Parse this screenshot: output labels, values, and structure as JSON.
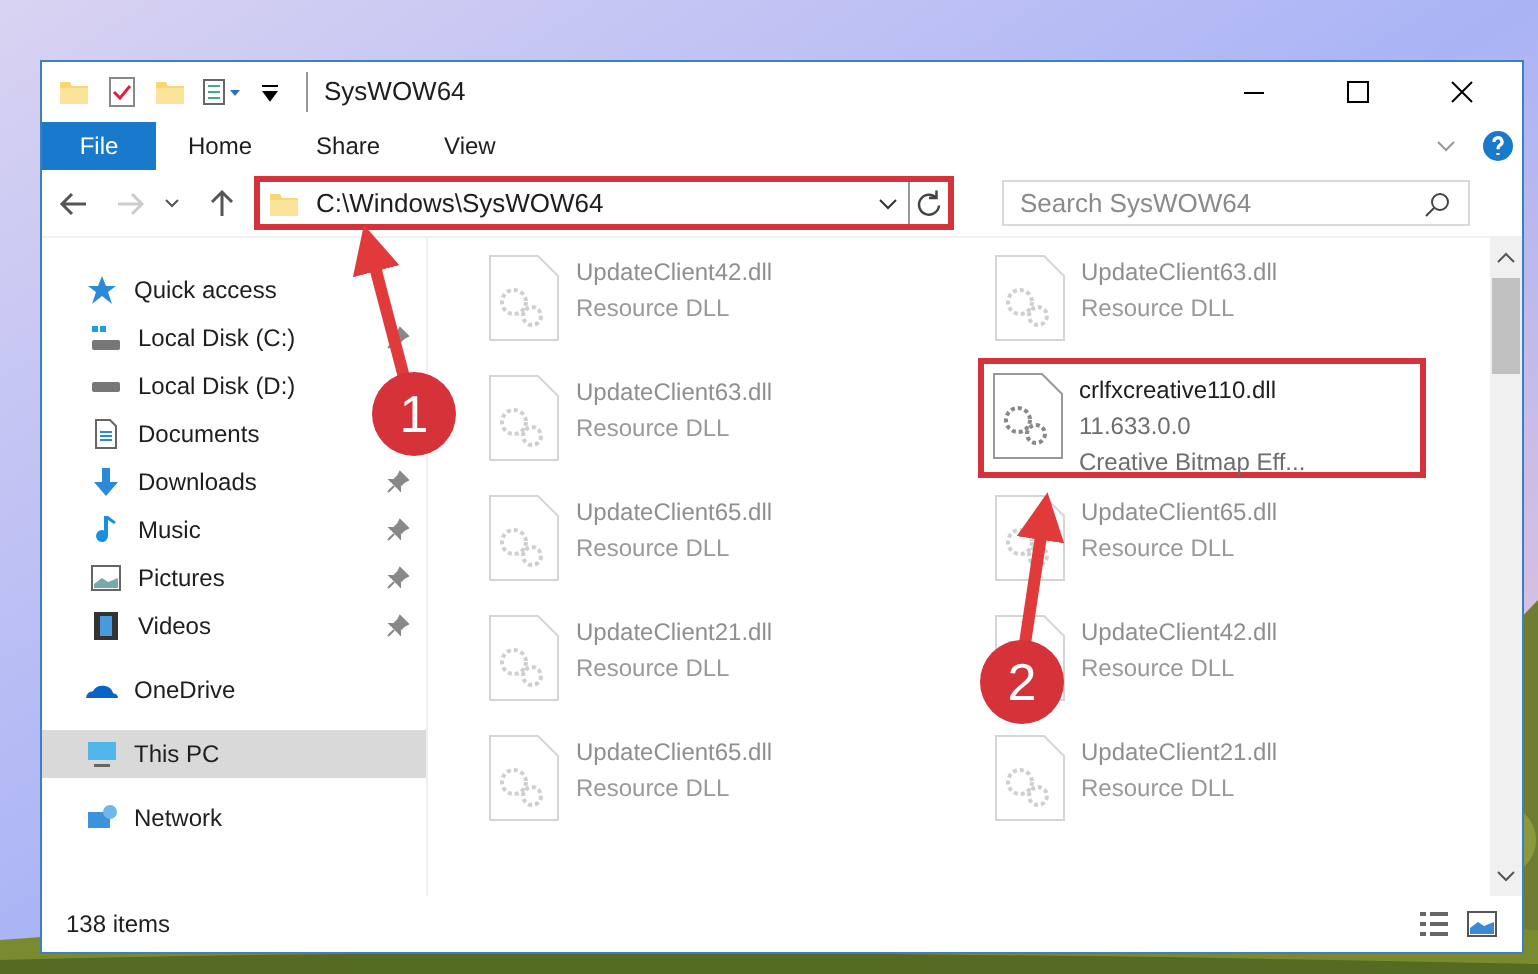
{
  "window": {
    "title": "SysWOW64"
  },
  "ribbon_tabs": [
    {
      "label": "File",
      "selected": true
    },
    {
      "label": "Home",
      "selected": false
    },
    {
      "label": "Share",
      "selected": false
    },
    {
      "label": "View",
      "selected": false
    }
  ],
  "address_bar": {
    "value": "C:\\Windows\\SysWOW64"
  },
  "search": {
    "placeholder": "Search SysWOW64"
  },
  "sidebar": {
    "items": [
      {
        "label": "Quick access",
        "kind": "star",
        "pinned": false,
        "selected": false,
        "children": [
          {
            "label": "Local Disk (C:)",
            "kind": "disk-c",
            "pinned": true,
            "selected": false
          },
          {
            "label": "Local Disk (D:)",
            "kind": "disk",
            "pinned": false,
            "selected": false
          },
          {
            "label": "Documents",
            "kind": "documents",
            "pinned": false,
            "selected": false
          },
          {
            "label": "Downloads",
            "kind": "downloads",
            "pinned": true,
            "selected": false
          },
          {
            "label": "Music",
            "kind": "music",
            "pinned": true,
            "selected": false
          },
          {
            "label": "Pictures",
            "kind": "pictures",
            "pinned": true,
            "selected": false
          },
          {
            "label": "Videos",
            "kind": "videos",
            "pinned": true,
            "selected": false
          }
        ]
      },
      {
        "label": "OneDrive",
        "kind": "cloud",
        "pinned": false,
        "selected": false
      },
      {
        "label": "This PC",
        "kind": "pc",
        "pinned": false,
        "selected": true
      },
      {
        "label": "Network",
        "kind": "network",
        "pinned": false,
        "selected": false
      }
    ]
  },
  "files": [
    {
      "name": "UpdateClient42.dll",
      "line_2": "Resource DLL",
      "highlighted": false
    },
    {
      "name": "UpdateClient63.dll",
      "line_2": "Resource DLL",
      "highlighted": false
    },
    {
      "name": "UpdateClient63.dll",
      "line_2": "Resource DLL",
      "highlighted": false
    },
    {
      "name": "crlfxcreative110.dll",
      "line_2": "11.633.0.0",
      "line_3": "Creative Bitmap Eff...",
      "highlighted": true
    },
    {
      "name": "UpdateClient65.dll",
      "line_2": "Resource DLL",
      "highlighted": false
    },
    {
      "name": "UpdateClient65.dll",
      "line_2": "Resource DLL",
      "highlighted": false
    },
    {
      "name": "UpdateClient21.dll",
      "line_2": "Resource DLL",
      "highlighted": false
    },
    {
      "name": "UpdateClient42.dll",
      "line_2": "Resource DLL",
      "highlighted": false
    },
    {
      "name": "UpdateClient65.dll",
      "line_2": "Resource DLL",
      "highlighted": false
    },
    {
      "name": "UpdateClient21.dll",
      "line_2": "Resource DLL",
      "highlighted": false
    }
  ],
  "status_bar": {
    "item_count": "138 items"
  },
  "annotations": [
    {
      "number": "1"
    },
    {
      "number": "2"
    }
  ]
}
